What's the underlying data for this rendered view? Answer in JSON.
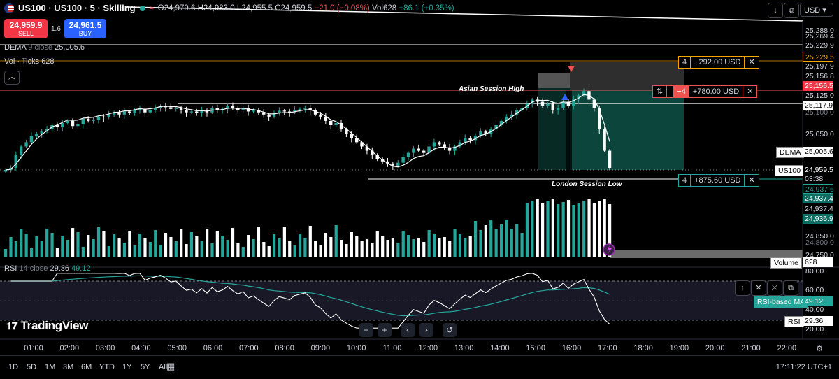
{
  "header": {
    "symbol": "US100 · US100 · 5 · Skilling",
    "wave": "≈",
    "o": "24,979.6",
    "h": "24,983.0",
    "l": "24,955.5",
    "c": "24,959.5",
    "change": "−21.0 (−0.08%)",
    "vol_label": "Vol",
    "vol": "628",
    "vol_change": "+86.1 (+0.35%)",
    "currency": "USD"
  },
  "trade": {
    "sell_price": "24,959.9",
    "sell_label": "SELL",
    "spread": "1.6",
    "buy_price": "24,961.5",
    "buy_label": "BUY"
  },
  "legends": {
    "dema_name": "DEMA",
    "dema_param": "9 close",
    "dema_value": "25,005.6",
    "vol_name": "Vol · Ticks",
    "vol_value": "628",
    "rsi_name": "RSI",
    "rsi_param": "14 close",
    "rsi_value": "29.36",
    "rsi_ma_value": "49.12"
  },
  "positions": [
    {
      "qty": "4",
      "pnl": "−292.00 USD",
      "close": "✕"
    },
    {
      "qty": "−4",
      "pnl": "+780.00 USD",
      "close": "✕",
      "reverse": "⇅"
    },
    {
      "qty": "4",
      "pnl": "+875.60 USD",
      "close": "✕"
    }
  ],
  "annotations": {
    "asian_high": "Asian Session High",
    "london_low": "London Session Low"
  },
  "price_axis": [
    {
      "v": "25,288.0"
    },
    {
      "v": "25,269.4"
    },
    {
      "v": "25,229.9"
    },
    {
      "v": "25,197.9"
    },
    {
      "v": "25,156.8"
    },
    {
      "v": "25,125.0"
    },
    {
      "v": "25,100.0"
    },
    {
      "v": "25,050.0"
    },
    {
      "v": "24,850.0"
    },
    {
      "v": "24,800.0"
    },
    {
      "v": "24,750.0"
    }
  ],
  "price_tags": {
    "orange": "25,229.5",
    "red": "25,156.5",
    "white": "25,117.9",
    "dema": "25,005.6",
    "dema_side": "DEMA",
    "us100": "24,959.5",
    "us100_side": "US100",
    "countdown": "03:38",
    "g1": "24,937.6",
    "g2": "24,937.4",
    "g3": "24,937.4",
    "g4": "24,936.9",
    "volume": "628",
    "volume_side": "Volume"
  },
  "rsi_axis": [
    {
      "v": "80.00"
    },
    {
      "v": "60.00"
    },
    {
      "v": "40.00"
    },
    {
      "v": "20.00"
    }
  ],
  "rsi_tags": {
    "ma": "49.12",
    "ma_side": "RSI-based MA",
    "rsi": "29.36",
    "rsi_side": "RSI"
  },
  "time_axis": [
    "01:00",
    "02:00",
    "03:00",
    "04:00",
    "05:00",
    "06:00",
    "07:00",
    "08:00",
    "09:00",
    "10:00",
    "11:00",
    "12:00",
    "13:00",
    "14:00",
    "15:00",
    "16:00",
    "17:00",
    "18:00",
    "19:00",
    "20:00",
    "21:00",
    "22:00"
  ],
  "ranges": [
    "1D",
    "5D",
    "1M",
    "3M",
    "6M",
    "YTD",
    "1Y",
    "5Y",
    "All"
  ],
  "clock": "17:11:22 UTC+1",
  "logo": "TradingView",
  "nav": [
    "−",
    "+",
    "‹",
    "›",
    "↺"
  ],
  "icons": {
    "down": "↓",
    "restore": "⧉",
    "up": "↑",
    "trash": "🗑",
    "collapse": "⤫",
    "window": "⧉",
    "calendar": "📅",
    "gear": "⚙",
    "collapse_legend": "︿",
    "lightning": "ϟ"
  },
  "colors": {
    "up": "#26a69a",
    "down": "#ef5350",
    "dema": "#ffffff",
    "rsi": "#ffffff",
    "rsi_ma": "#26a69a",
    "zone_green": "#0d4d43",
    "zone_grey": "#5d5d5d"
  },
  "chart_data": {
    "type": "candlestick",
    "x_axis": "time (5m bars)",
    "candle_closes_approx": [
      24955,
      24960,
      24990,
      25010,
      25020,
      25035,
      25040,
      25045,
      25050,
      25060,
      25055,
      25065,
      25070,
      25058,
      25062,
      25075,
      25070,
      25072,
      25080,
      25078,
      25085,
      25090,
      25085,
      25092,
      25088,
      25095,
      25098,
      25090,
      25096,
      25100,
      25105,
      25102,
      25098,
      25100,
      25095,
      25090,
      25092,
      25088,
      25095,
      25090,
      25100,
      25095,
      25098,
      25105,
      25100,
      25096,
      25100,
      25092,
      25095,
      25090,
      25085,
      25080,
      25088,
      25094,
      25092,
      25090,
      25096,
      25098,
      25100,
      25095,
      25085,
      25080,
      25070,
      25060,
      25065,
      25050,
      25040,
      25030,
      25020,
      25010,
      25000,
      24990,
      24980,
      24975,
      24970,
      24965,
      24972,
      24985,
      24995,
      25005,
      25000,
      24995,
      25010,
      25020,
      25015,
      25008,
      25000,
      25010,
      25020,
      25030,
      25025,
      25035,
      25045,
      25040,
      25050,
      25060,
      25070,
      25080,
      25085,
      25095,
      25100,
      25110,
      25120,
      25115,
      25105,
      25110,
      25095,
      25100,
      25115,
      25105,
      25120,
      25130,
      25140,
      25120,
      25100,
      25050,
      25000,
      24960
    ],
    "dema": {
      "name": "DEMA 9 close",
      "last": 25005.6
    },
    "rsi": {
      "name": "RSI 14 close",
      "last": 29.36,
      "ma_last": 49.12,
      "bands": [
        30,
        70
      ],
      "ylim": [
        20,
        80
      ]
    },
    "volume_last": 628,
    "ylim": [
      24750,
      25288
    ]
  }
}
